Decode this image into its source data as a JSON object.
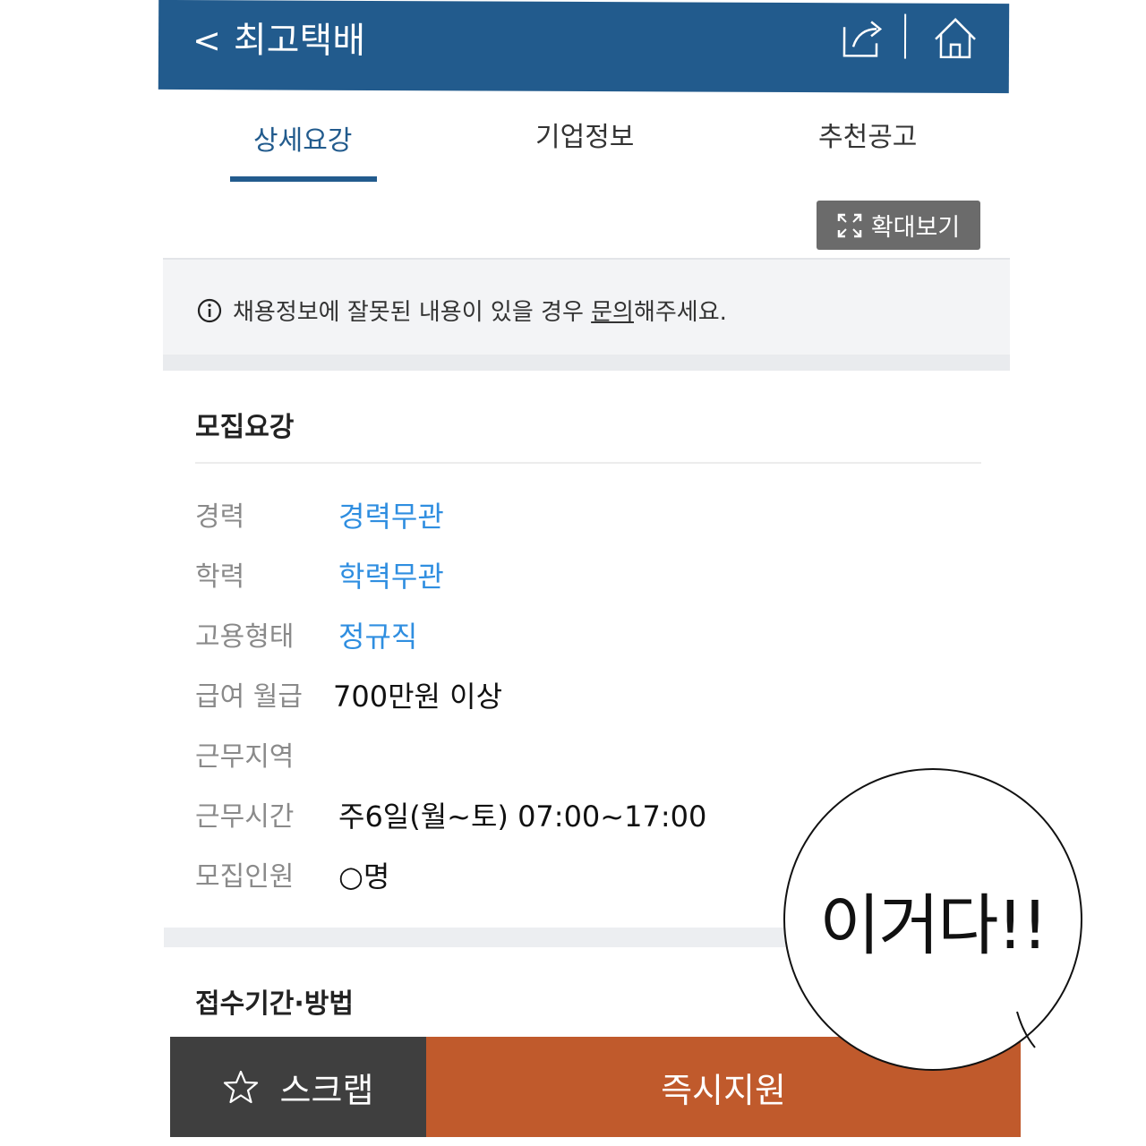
{
  "header": {
    "back_glyph": "<",
    "title": "최고택배",
    "share_icon": "share-icon",
    "home_icon": "home-icon",
    "background": "#225b8d"
  },
  "tabs": [
    {
      "label": "상세요강",
      "active": true
    },
    {
      "label": "기업정보",
      "active": false
    },
    {
      "label": "추천공고",
      "active": false
    }
  ],
  "zoom_button": {
    "label": "확대보기",
    "icon": "expand-icon"
  },
  "notice": {
    "text_before": "채용정보에 잘못된 내용이 있을 경우 ",
    "link": "문의",
    "text_after": "해주세요."
  },
  "recruitment": {
    "title": "모집요강",
    "rows": [
      {
        "label": "경력",
        "value": "경력무관"
      },
      {
        "label": "학력",
        "value": "학력무관"
      },
      {
        "label": "고용형태",
        "value": "정규직"
      },
      {
        "label": "급여 월급",
        "value": "700만원 이상"
      },
      {
        "label": "근무지역",
        "value": ""
      },
      {
        "label": "근무시간",
        "value": "주6일(월~토) 07:00~17:00"
      },
      {
        "label": "모집인원",
        "value": "○명"
      }
    ]
  },
  "application": {
    "title": "접수기간·방법"
  },
  "bottom_bar": {
    "scrap_label": "스크랩",
    "scrap_icon": "star-icon",
    "apply_label": "즉시지원"
  },
  "speech_bubble": {
    "text": "이거다!!"
  },
  "colors": {
    "accent": "#225b8d",
    "link_blue": "#2f8ee0",
    "apply_orange": "#c05a2c",
    "scrap_gray": "#3f3f3f"
  }
}
